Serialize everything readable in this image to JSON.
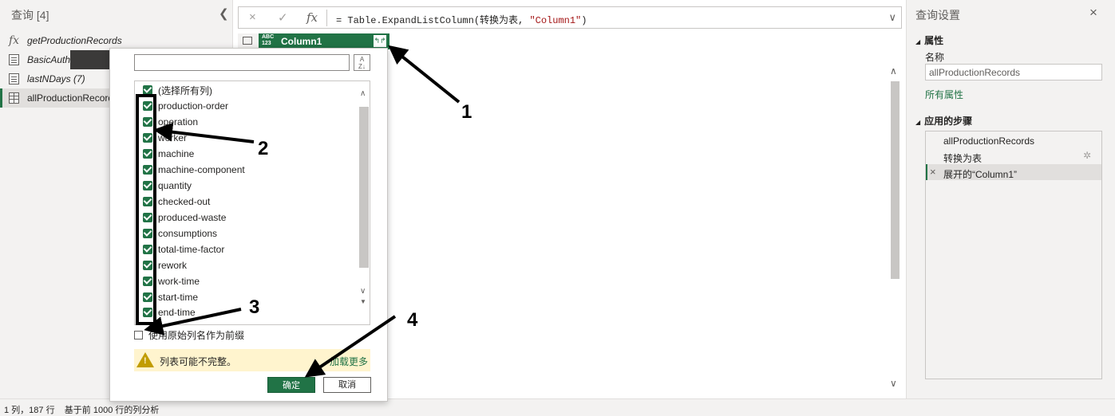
{
  "left_pane": {
    "title": "查询 [4]",
    "collapse_icon": "chevron-left-icon",
    "queries": [
      {
        "label": "getProductionRecords",
        "icon": "fx-icon"
      },
      {
        "label": "BasicAuth",
        "icon": "document-icon"
      },
      {
        "label": "lastNDays (7)",
        "icon": "document-icon"
      },
      {
        "label": "allProductionRecords",
        "icon": "table-icon",
        "selected": true
      }
    ]
  },
  "formula_bar": {
    "cancel_icon": "×",
    "commit_icon": "✓",
    "fx_label": "fx",
    "formula_prefix": "= Table.ExpandListColumn(转换为表, ",
    "formula_string": "\"Column1\"",
    "formula_suffix": ")",
    "expand_icon": "chevron-down-icon"
  },
  "grid": {
    "column_type": "ABC\n123",
    "column_name": "Column1",
    "expand_button": "↰↱"
  },
  "popup": {
    "select_all_label": "(选择所有列)",
    "columns": [
      "production-order",
      "operation",
      "worker",
      "machine",
      "machine-component",
      "quantity",
      "checked-out",
      "produced-waste",
      "consumptions",
      "total-time-factor",
      "rework",
      "work-time",
      "start-time",
      "end-time"
    ],
    "sort_label": "A\nZ",
    "prefix_label": "使用原始列名作为前缀",
    "warning_text": "列表可能不完整。",
    "load_more": "加载更多",
    "ok": "确定",
    "cancel": "取消"
  },
  "right_pane": {
    "title": "查询设置",
    "close_icon": "×",
    "properties_header": "属性",
    "name_label": "名称",
    "name_value": "allProductionRecords",
    "all_properties": "所有属性",
    "steps_header": "应用的步骤",
    "steps": [
      {
        "label": "allProductionRecords"
      },
      {
        "label": "转换为表",
        "gear": "✲"
      },
      {
        "label": "展开的“Column1”",
        "selected": true,
        "delete_icon": "×"
      }
    ]
  },
  "status_bar": {
    "text": "1 列，187 行    基于前 1000 行的列分析"
  },
  "annotations": {
    "labels": [
      "1",
      "2",
      "3",
      "4"
    ]
  },
  "colors": {
    "accent": "#217346",
    "warning_bg": "#fff4ce",
    "pane_bg": "#f3f2f1"
  }
}
